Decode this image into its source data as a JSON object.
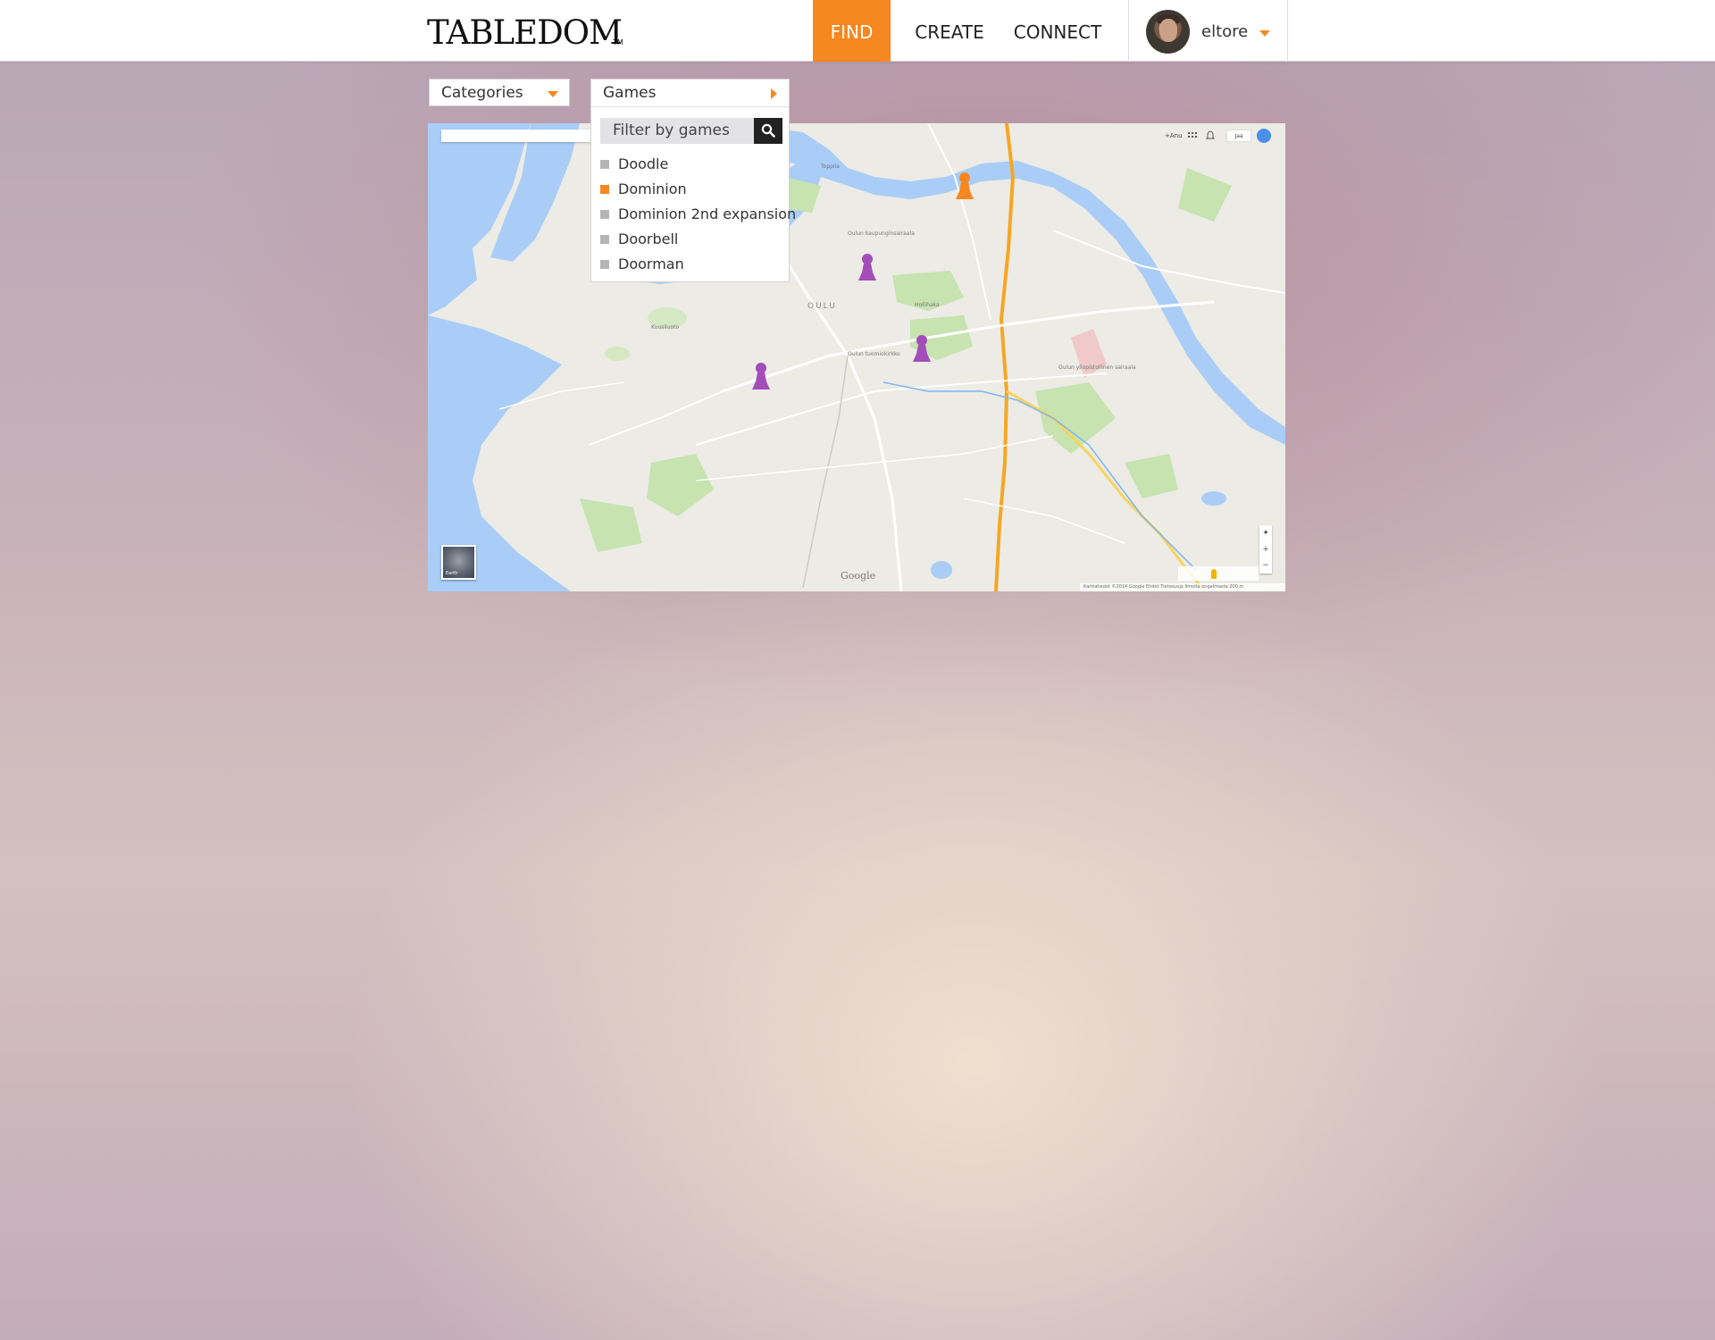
{
  "header": {
    "logo": "TABLEDOM",
    "logo_tm": "TM",
    "nav": {
      "find": "FIND",
      "create": "CREATE",
      "connect": "CONNECT"
    },
    "user": {
      "name": "eltore"
    },
    "accent_color": "#f7871f"
  },
  "filters": {
    "categories_label": "Categories",
    "games_label": "Games",
    "search_placeholder": "Filter by games",
    "games": [
      {
        "label": "Doodle",
        "selected": false
      },
      {
        "label": "Dominion",
        "selected": true
      },
      {
        "label": "Dominion 2nd expansion",
        "selected": false
      },
      {
        "label": "Doorbell",
        "selected": false
      },
      {
        "label": "Doorman",
        "selected": false
      }
    ]
  },
  "map": {
    "city_label": "OULU",
    "google_label": "Google",
    "earth_label": "Earth",
    "share_label": "Jaa",
    "top_user_label": "+Anu",
    "attribution": "Karttatiedot ©2014 Google   Ehdot   Tietosuoja   Ilmoita ongelmasta   200 m",
    "place_labels": [
      "Hollihaka",
      "Oulun yliopistollinen sairaala",
      "Oulun kaupunginsairaala",
      "Kuusiluoto",
      "Oulun tuomiokirkko",
      "Toppila"
    ],
    "marker_colors": {
      "selected": "#f7871f",
      "other": "#a24db8"
    },
    "markers": [
      {
        "game": "Dominion",
        "selected": true
      },
      {
        "game": "other",
        "selected": false
      },
      {
        "game": "other",
        "selected": false
      },
      {
        "game": "other",
        "selected": false
      }
    ]
  }
}
